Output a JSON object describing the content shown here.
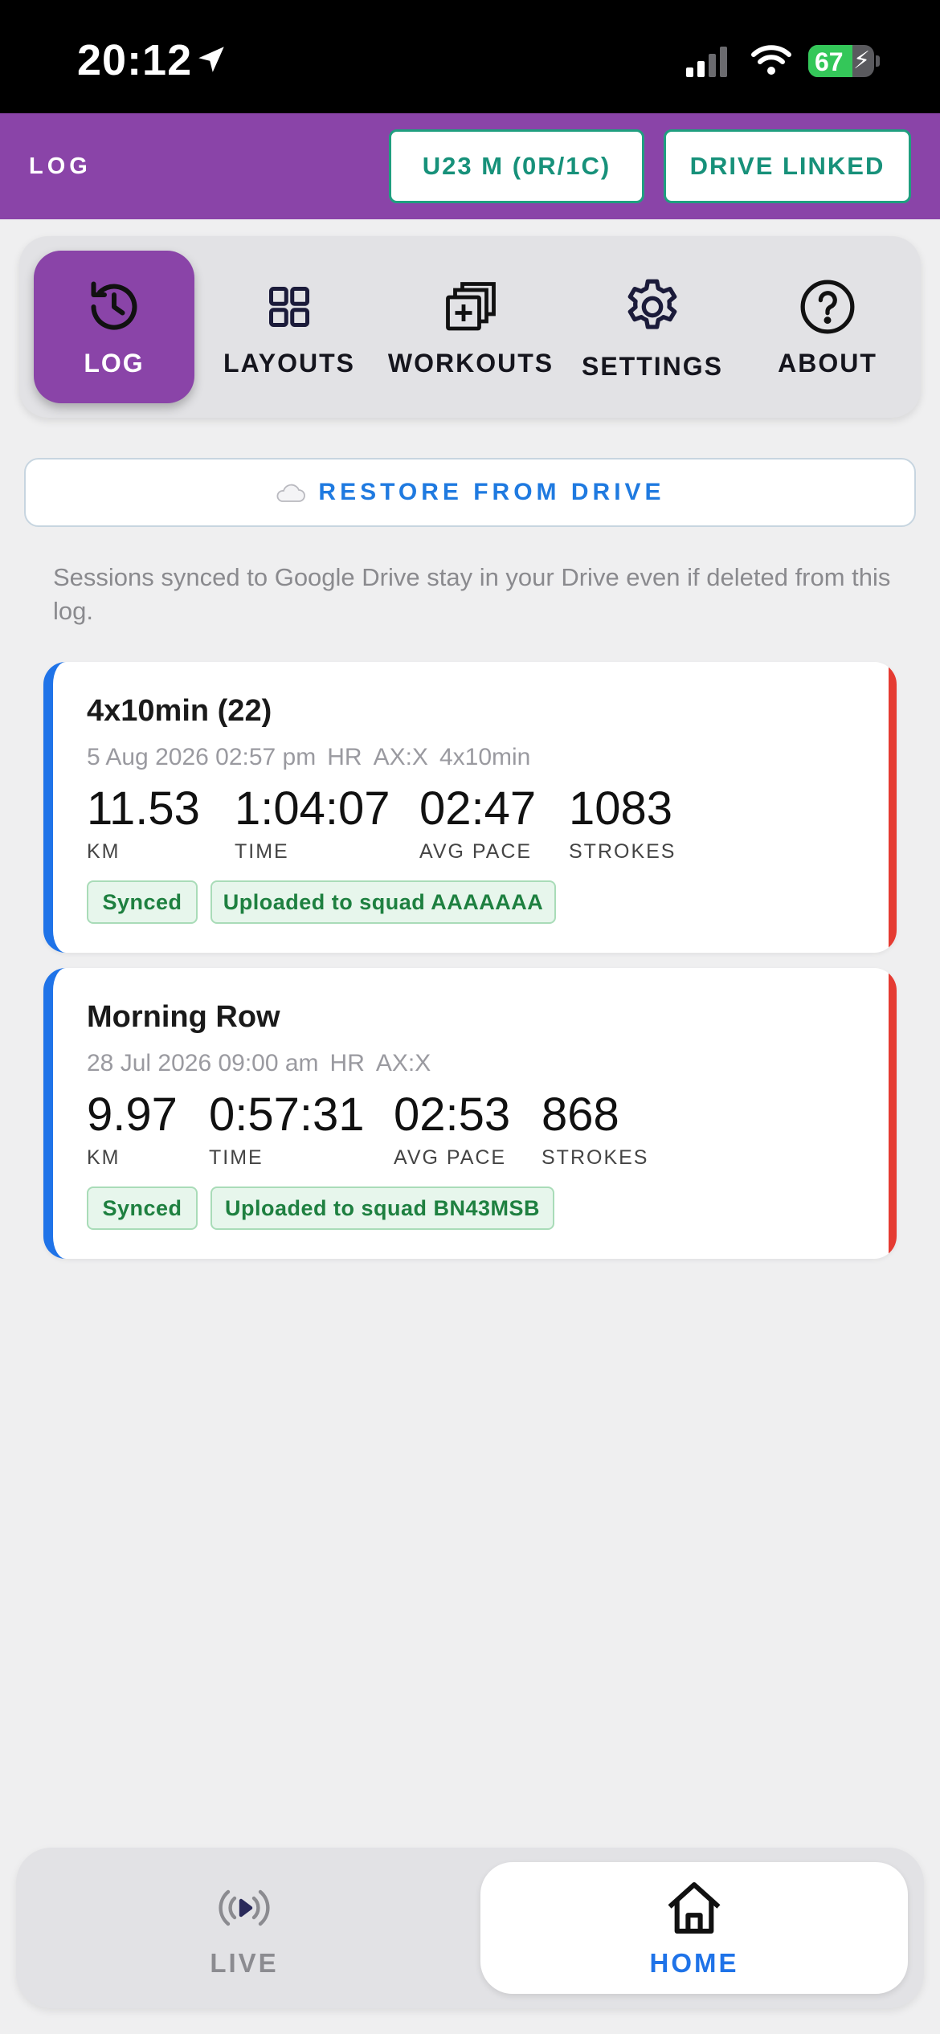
{
  "status_bar": {
    "time": "20:12",
    "battery_percent": "67",
    "battery_level": 0.67
  },
  "header": {
    "title": "LOG",
    "squad_button": "U23 M (0R/1C)",
    "drive_button": "DRIVE LINKED"
  },
  "nav": {
    "tabs": [
      {
        "label": "LOG",
        "icon": "history-icon",
        "active": true
      },
      {
        "label": "LAYOUTS",
        "icon": "grid-icon",
        "active": false
      },
      {
        "label": "WORKOUTS",
        "icon": "stack-add-icon",
        "active": false
      },
      {
        "label": "SETTINGS",
        "icon": "gear-icon",
        "active": false
      },
      {
        "label": "ABOUT",
        "icon": "help-circle-icon",
        "active": false
      }
    ]
  },
  "restore_button": "RESTORE FROM DRIVE",
  "note": "Sessions synced to Google Drive stay in your Drive even if deleted from this log.",
  "sessions": [
    {
      "title": "4x10min (22)",
      "date": "5 Aug 2026 02:57 pm",
      "tags": [
        "HR",
        "AX:X",
        "4x10min"
      ],
      "stats": [
        {
          "value": "11.53",
          "label": "KM"
        },
        {
          "value": "1:04:07",
          "label": "TIME"
        },
        {
          "value": "02:47",
          "label": "AVG PACE"
        },
        {
          "value": "1083",
          "label": "STROKES"
        }
      ],
      "badges": [
        "Synced",
        "Uploaded to squad AAAAAAA"
      ]
    },
    {
      "title": "Morning Row",
      "date": "28 Jul 2026 09:00 am",
      "tags": [
        "HR",
        "AX:X"
      ],
      "stats": [
        {
          "value": "9.97",
          "label": "KM"
        },
        {
          "value": "0:57:31",
          "label": "TIME"
        },
        {
          "value": "02:53",
          "label": "AVG PACE"
        },
        {
          "value": "868",
          "label": "STROKES"
        }
      ],
      "badges": [
        "Synced",
        "Uploaded to squad BN43MSB"
      ]
    }
  ],
  "bottom_nav": {
    "items": [
      {
        "label": "LIVE",
        "icon": "broadcast-play-icon",
        "active": false
      },
      {
        "label": "HOME",
        "icon": "home-icon",
        "active": true
      }
    ]
  },
  "colors": {
    "brand_purple": "#8a44a8",
    "accent_blue": "#1f73e8",
    "teal": "#17917a",
    "sync_green": "#1e8040",
    "alert_red": "#e53b32"
  }
}
